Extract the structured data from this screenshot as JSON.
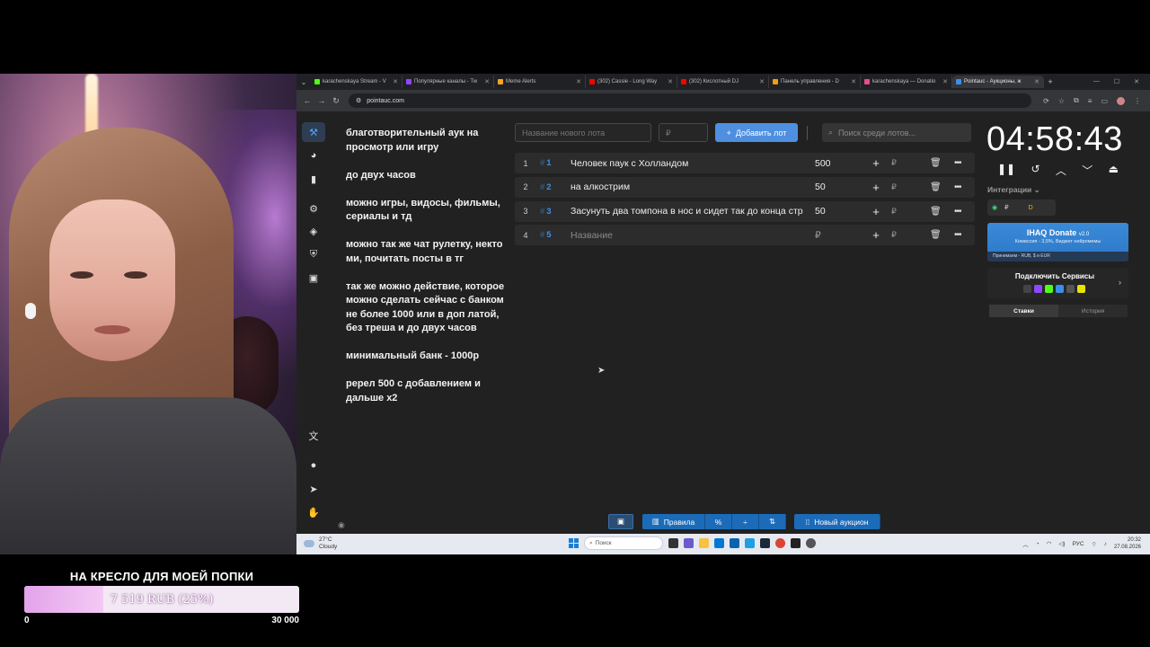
{
  "goal": {
    "title": "НА КРЕСЛО ДЛЯ МОЕЙ ПОПКИ",
    "amount_text": "7 519 RUB (25%)",
    "progress_fraction": 0.25,
    "min": "0",
    "max": "30 000"
  },
  "browser": {
    "tabs": [
      {
        "label": "karachenskaya Stream - V",
        "color": "#53fc18"
      },
      {
        "label": "Популярные каналы - Tw",
        "color": "#9146ff"
      },
      {
        "label": "Meme Alerts",
        "color": "#f5a623"
      },
      {
        "label": "(302) Cassie - Long Way",
        "color": "#ff0000"
      },
      {
        "label": "(302) Кислотный DJ",
        "color": "#ff0000"
      },
      {
        "label": "Панель управления - D",
        "color": "#f39c12"
      },
      {
        "label": "karachenskaya — Donatio",
        "color": "#e74c8c"
      },
      {
        "label": "Pointauc - Аукционы, ж",
        "color": "#3d8ee8"
      }
    ],
    "url": "pointauc.com"
  },
  "rules": [
    "благотворительный аук на просмотр или игру",
    "до  двух часов",
    "можно игры, видосы, фильмы, сериалы и тд",
    "можно так же чат рулетку, некто ми, почитать посты в тг",
    "так же можно действие, которое можно сделать сейчас с банком не более 1000 или в доп латой, без треша  и до двух часов",
    "минимальный банк - 1000р",
    "ререл 500 с добавлением и дальше х2"
  ],
  "toolbar": {
    "name_placeholder": "Название нового лота",
    "price_placeholder": "₽",
    "add_label": "Добавить лот",
    "search_placeholder": "Поиск среди лотов..."
  },
  "lots": [
    {
      "num": "1",
      "id": "1",
      "name": "Человек паук с Холландом",
      "amount": "500",
      "placeholder": false
    },
    {
      "num": "2",
      "id": "2",
      "name": "на алкострим",
      "amount": "50",
      "placeholder": false
    },
    {
      "num": "3",
      "id": "3",
      "name": "Засунуть два томпона в нос и сидет так до конца стр",
      "amount": "50",
      "placeholder": false
    },
    {
      "num": "4",
      "id": "5",
      "name": "Название",
      "amount": "₽",
      "placeholder": true
    }
  ],
  "currency": "₽",
  "timer": "04:58:43",
  "integrations_label": "Интеграции",
  "donate": {
    "title": "IHAQ Donate",
    "version": "v2.0",
    "sub": "Комиссия - 3,5%, Виджет нейромемы",
    "pay": "Принимаем - RUB, $ и EUR"
  },
  "connect_title": "Подключить Сервисы",
  "side_tabs": {
    "bets": "Ставки",
    "history": "История"
  },
  "bottom": {
    "rules": "Правила",
    "new_auction": "Новый аукцион"
  },
  "taskbar": {
    "temp": "27°C",
    "weather": "Cloudy",
    "search": "Поиск",
    "lang": "РУС",
    "time": "20:32",
    "date": "27.08.2026"
  }
}
